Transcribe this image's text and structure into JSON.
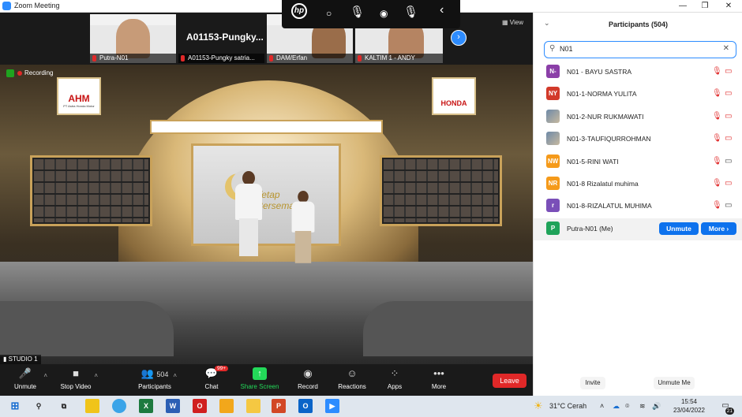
{
  "window": {
    "title": "Zoom Meeting",
    "minimize": "—",
    "restore": "❐",
    "close": "✕"
  },
  "thumbs": [
    {
      "caption": "Putra-N01"
    },
    {
      "name": "A01153-Pungky...",
      "caption": "A01153-Pungky satria..."
    },
    {
      "caption": "DAM/Erfan"
    },
    {
      "caption": "KALTIM 1 - ANDY"
    }
  ],
  "hp_bar": {
    "logo": "hp",
    "icons": [
      "○",
      "⦿",
      "◉",
      "⌖",
      "‹"
    ]
  },
  "view_label": "View",
  "stage": {
    "recording": "Recording",
    "studio_label": "STUDIO 1",
    "logo_left": "AHM",
    "logo_left_sub": "PT Astra Honda Motor",
    "logo_right": "HONDA",
    "screen_script": "Tetap Bersemangat"
  },
  "toolbar": {
    "unmute": "Unmute",
    "stop_video": "Stop Video",
    "participants": "Participants",
    "participants_count": "504",
    "chat": "Chat",
    "chat_badge": "99+",
    "share_screen": "Share Screen",
    "record": "Record",
    "reactions": "Reactions",
    "apps": "Apps",
    "more": "More",
    "leave": "Leave"
  },
  "panel": {
    "title": "Participants (504)",
    "search_value": "N01",
    "participants": [
      {
        "initials": "N-",
        "color": "#8b3fa8",
        "name": "N01 - BAYU SASTRA",
        "cam": "off"
      },
      {
        "initials": "NY",
        "color": "#d23a2a",
        "name": "N01-1-NORMA YULITA",
        "cam": "off"
      },
      {
        "initials": "",
        "color": "",
        "name": "N01-2-NUR RUKMAWATI",
        "cam": "off"
      },
      {
        "initials": "",
        "color": "",
        "name": "N01-3-TAUFIQURROHMAN",
        "cam": "off"
      },
      {
        "initials": "NW",
        "color": "#f59a1a",
        "name": "N01-5-RINI WATI",
        "cam": "on"
      },
      {
        "initials": "NR",
        "color": "#f59a1a",
        "name": "N01-8 Rizalatul muhima",
        "cam": "off"
      },
      {
        "initials": "r",
        "color": "#7a4fb8",
        "name": "N01-8-RIZALATUL MUHIMA",
        "cam": "on"
      },
      {
        "initials": "P",
        "color": "#1fa35a",
        "name": "Putra-N01 (Me)",
        "cam": "me"
      }
    ],
    "unmute_btn": "Unmute",
    "more_btn": "More ›",
    "invite": "Invite",
    "unmute_me": "Unmute Me"
  },
  "taskbar": {
    "weather": "31°C  Cerah",
    "time": "15:54",
    "date": "23/04/2022",
    "notif_count": "21"
  }
}
